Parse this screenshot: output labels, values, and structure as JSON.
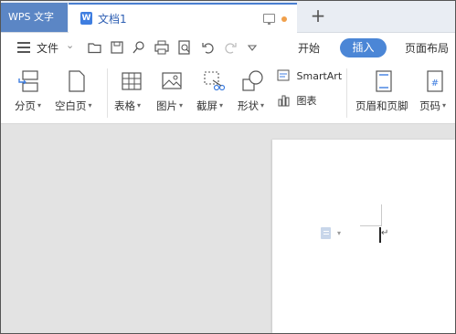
{
  "tabbar": {
    "app_tab": "WPS 文字",
    "doc_tab": "文档1",
    "doc_tab_badge": "W",
    "new_tab": "+"
  },
  "menu": {
    "file": "文件",
    "file_caret": "⌄",
    "tabs": [
      "开始",
      "插入",
      "页面布局"
    ],
    "active_tab": "插入"
  },
  "ribbon": {
    "items": [
      {
        "label": "分页",
        "icon": "page-break-icon"
      },
      {
        "label": "空白页",
        "icon": "blank-page-icon"
      },
      {
        "label": "表格",
        "icon": "table-icon"
      },
      {
        "label": "图片",
        "icon": "picture-icon"
      },
      {
        "label": "截屏",
        "icon": "screenshot-icon"
      },
      {
        "label": "形状",
        "icon": "shapes-icon"
      },
      {
        "label": "页眉和页脚",
        "icon": "header-footer-icon"
      },
      {
        "label": "页码",
        "icon": "page-number-icon"
      }
    ],
    "smartart": "SmartArt",
    "chart": "图表",
    "caret": "▾"
  },
  "document": {
    "paragraph_mark": "↵"
  },
  "colors": {
    "accent": "#4b86d6",
    "app_tab_bg": "#5b86c5",
    "workspace_bg": "#e3e3e3"
  }
}
